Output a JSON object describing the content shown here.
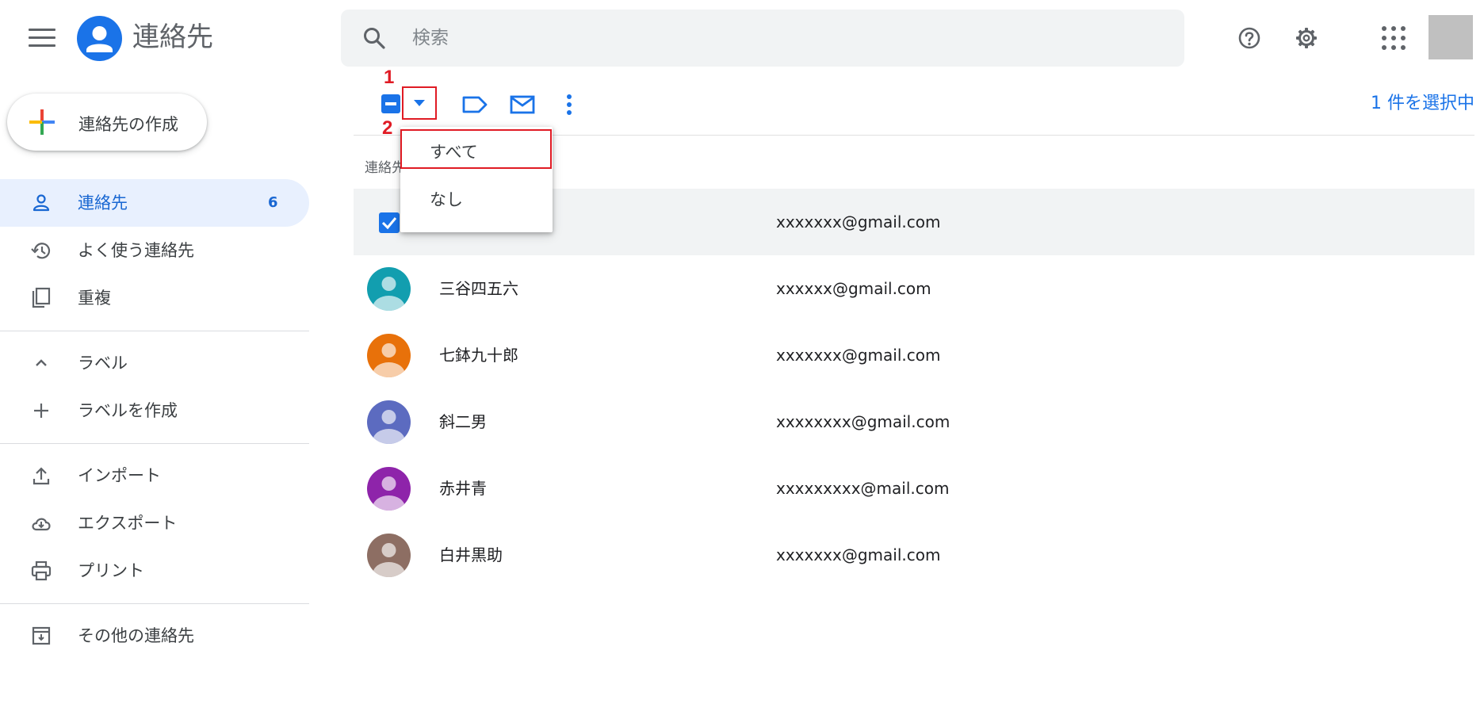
{
  "header": {
    "app_title": "連絡先",
    "search_placeholder": "検索"
  },
  "sidebar": {
    "create_label": "連絡先の作成",
    "items": [
      {
        "label": "連絡先",
        "count": "6",
        "icon": "person-icon",
        "active": true
      },
      {
        "label": "よく使う連絡先",
        "icon": "history-icon"
      },
      {
        "label": "重複",
        "icon": "copy-icon"
      }
    ],
    "labels_section": {
      "label": "ラベル",
      "icon": "chevron-up-icon"
    },
    "create_label_item": {
      "label": "ラベルを作成",
      "icon": "plus-icon"
    },
    "actions": [
      {
        "label": "インポート",
        "icon": "upload-icon"
      },
      {
        "label": "エクスポート",
        "icon": "cloud-download-icon"
      },
      {
        "label": "プリント",
        "icon": "print-icon"
      }
    ],
    "other_contacts": {
      "label": "その他の連絡先",
      "icon": "archive-icon"
    }
  },
  "toolbar": {
    "selection_count": "1 件を選択中",
    "annotation_1": "1",
    "annotation_2": "2"
  },
  "dropdown": {
    "items": [
      "すべて",
      "なし"
    ]
  },
  "list": {
    "header": "連絡先",
    "rows": [
      {
        "name": "",
        "email": "xxxxxxx@gmail.com",
        "selected": true,
        "color": "#1a73e8"
      },
      {
        "name": "三谷四五六",
        "email": "xxxxxx@gmail.com",
        "color": "#129eaf"
      },
      {
        "name": "七鉢九十郎",
        "email": "xxxxxxx@gmail.com",
        "color": "#e8710a"
      },
      {
        "name": "斜二男",
        "email": "xxxxxxxx@gmail.com",
        "color": "#5c6bc0"
      },
      {
        "name": "赤井青",
        "email": "xxxxxxxxx@mail.com",
        "color": "#8e24aa"
      },
      {
        "name": "白井黒助",
        "email": "xxxxxxx@gmail.com",
        "color": "#8d6e63"
      }
    ]
  },
  "colors": {
    "accent": "#1a73e8",
    "annotation": "#e01b24",
    "active_bg": "#e8f0fe"
  }
}
